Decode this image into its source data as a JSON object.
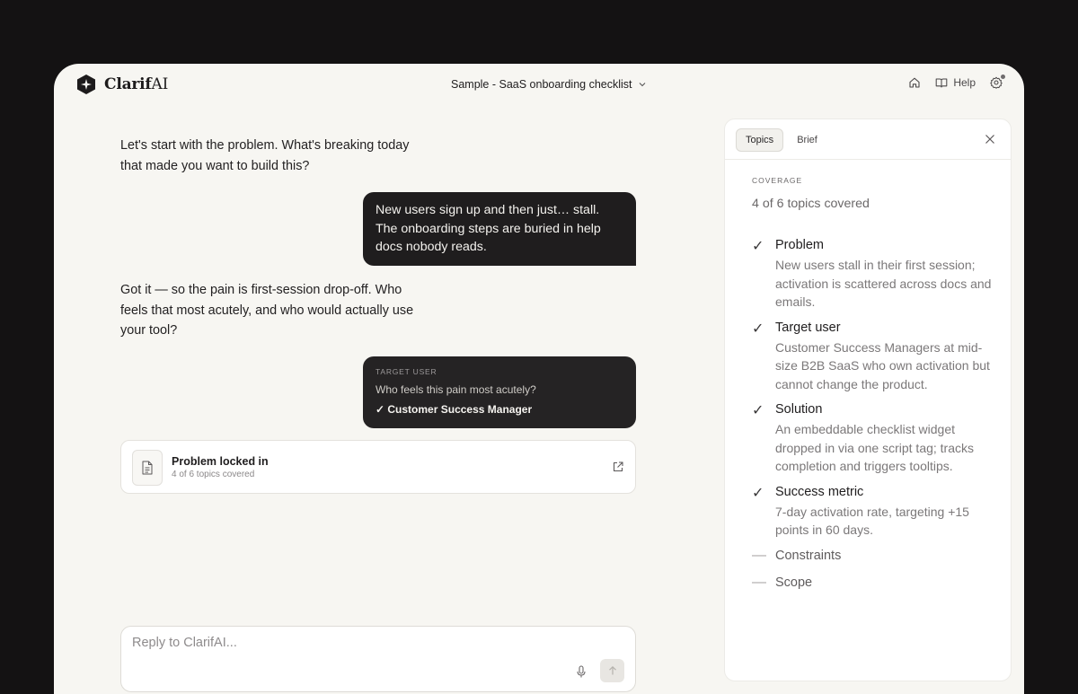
{
  "app": {
    "logo_main": "Clarif",
    "logo_accent": "AI"
  },
  "header": {
    "doc_title": "Sample - SaaS onboarding checklist",
    "help_label": "Help"
  },
  "chat": {
    "messages": [
      {
        "role": "assistant",
        "text": "Let's start with the problem. What's breaking today that made you want to build this?"
      },
      {
        "role": "user",
        "text": "New users sign up and then just… stall. The onboarding steps are buried in help docs nobody reads."
      },
      {
        "role": "assistant",
        "text": "Got it — so the pain is first-session drop-off. Who feels that most acutely, and who would actually use your tool?"
      }
    ],
    "answer_card": {
      "kicker": "TARGET USER",
      "question": "Who feels this pain most acutely?",
      "answer": "✓ Customer Success Manager"
    },
    "locked_card": {
      "title": "Problem locked in",
      "subtitle": "4 of 6 topics covered"
    }
  },
  "reply": {
    "placeholder": "Reply to ClarifAI..."
  },
  "panel": {
    "tabs": [
      "Topics",
      "Brief"
    ],
    "coverage_label": "COVERAGE",
    "coverage_count": "4 of 6 topics covered",
    "topics": [
      {
        "title": "Problem",
        "status": "done",
        "desc": "New users stall in their first session; activation is scattered across docs and emails."
      },
      {
        "title": "Target user",
        "status": "done",
        "desc": "Customer Success Managers at mid-size B2B SaaS who own activation but cannot change the product."
      },
      {
        "title": "Solution",
        "status": "done",
        "desc": "An embeddable checklist widget dropped in via one script tag; tracks completion and triggers tooltips."
      },
      {
        "title": "Success metric",
        "status": "done",
        "desc": "7-day activation rate, targeting +15 points in 60 days."
      },
      {
        "title": "Constraints",
        "status": "pending",
        "desc": ""
      },
      {
        "title": "Scope",
        "status": "pending",
        "desc": ""
      }
    ],
    "done_mark": "✓",
    "pending_mark": "—"
  }
}
